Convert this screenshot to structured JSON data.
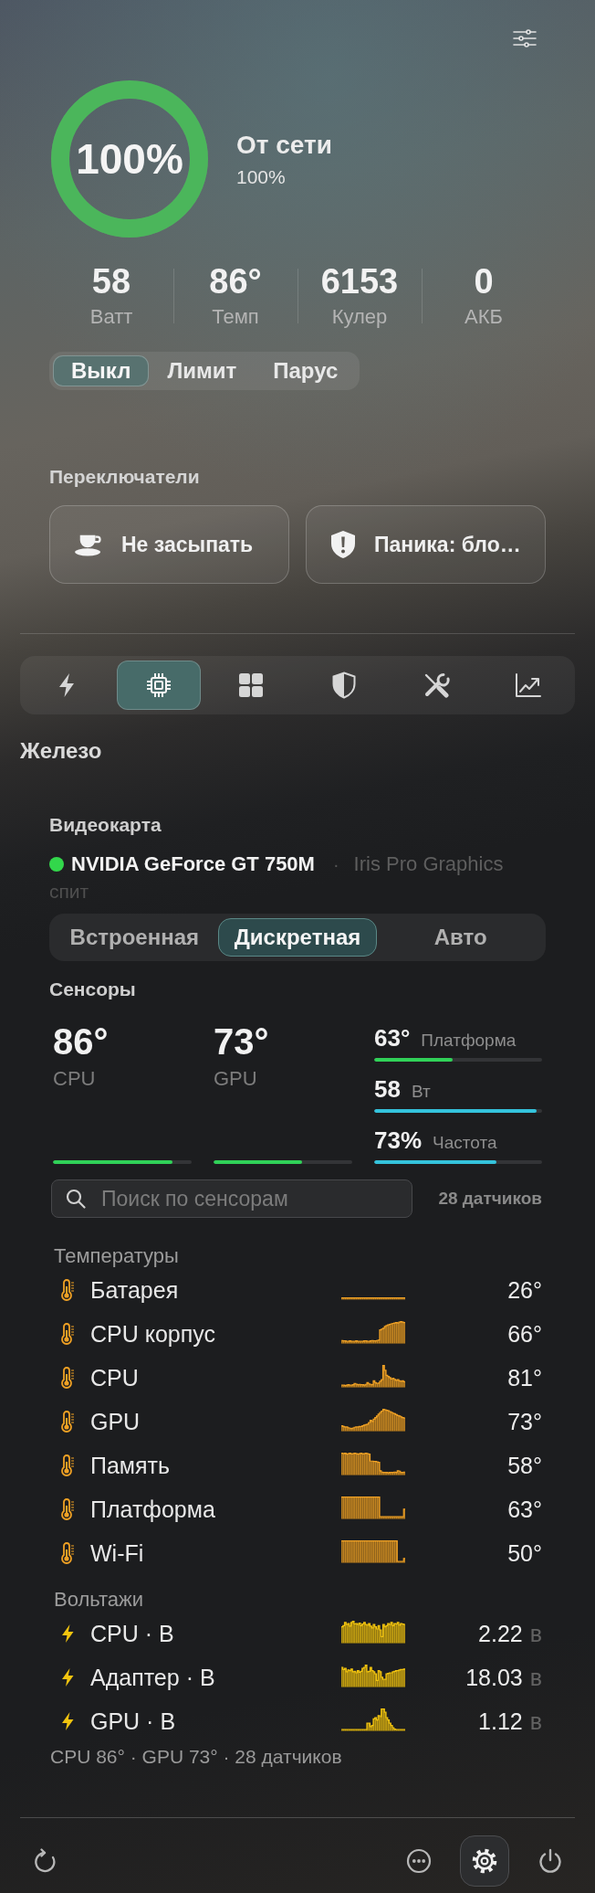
{
  "power": {
    "ring_label": "100%",
    "level": 1,
    "source": "От сети",
    "charge": "100%"
  },
  "stats": [
    {
      "value": "58",
      "label": "Ватт"
    },
    {
      "value": "86°",
      "label": "Темп"
    },
    {
      "value": "6153",
      "label": "Кулер"
    },
    {
      "value": "0",
      "label": "АКБ"
    }
  ],
  "charge_modes": [
    {
      "label": "Выкл",
      "selected": true
    },
    {
      "label": "Лимит",
      "selected": false
    },
    {
      "label": "Парус",
      "selected": false
    }
  ],
  "switches": {
    "heading": "Переключатели",
    "items": [
      {
        "label": "Не засыпать"
      },
      {
        "label": "Паника: бло…"
      }
    ]
  },
  "tabs": [
    {
      "selected": false
    },
    {
      "selected": true
    },
    {
      "selected": false
    },
    {
      "selected": false
    },
    {
      "selected": false
    },
    {
      "selected": false
    }
  ],
  "section_title": "Железо",
  "gpu": {
    "heading": "Видеокарта",
    "active": "NVIDIA GeForce GT 750M",
    "separator": "·",
    "inactive": "Iris Pro Graphics",
    "inactive_status": "спит",
    "modes": [
      {
        "label": "Встроенная",
        "selected": false
      },
      {
        "label": "Дискретная",
        "selected": true
      },
      {
        "label": "Авто",
        "selected": false
      }
    ]
  },
  "sensors": {
    "heading": "Сенсоры",
    "main": [
      {
        "value": "86°",
        "label": "CPU",
        "level": 0.86
      },
      {
        "value": "73°",
        "label": "GPU",
        "level": 0.64
      }
    ],
    "meters": [
      {
        "value": "63°",
        "label": "Платформа",
        "level": 0.47,
        "color": "#30d158"
      },
      {
        "value": "58",
        "label": "Вт",
        "level": 0.97,
        "color": "#34c3dc"
      },
      {
        "value": "73%",
        "label": "Частота",
        "level": 0.73,
        "color": "#34c3dc"
      }
    ],
    "search": {
      "placeholder": "Поиск по сенсорам"
    },
    "count": "28 датчиков",
    "groups": [
      {
        "kind": "temperature",
        "title": "Температуры",
        "rows": [
          {
            "name": "Батарея",
            "value": "26°"
          },
          {
            "name": "CPU корпус",
            "value": "66°"
          },
          {
            "name": "CPU",
            "value": "81°"
          },
          {
            "name": "GPU",
            "value": "73°"
          },
          {
            "name": "Память",
            "value": "58°"
          },
          {
            "name": "Платформа",
            "value": "63°"
          },
          {
            "name": "Wi-Fi",
            "value": "50°"
          }
        ]
      },
      {
        "kind": "voltage",
        "title": "Вольтажи",
        "rows": [
          {
            "name": "CPU · В",
            "value": "2.22",
            "unit": "в"
          },
          {
            "name": "Адаптер · В",
            "value": "18.03",
            "unit": "в"
          },
          {
            "name": "GPU · В",
            "value": "1.12",
            "unit": "в"
          }
        ]
      }
    ],
    "summary": "CPU 86° · GPU 73° · 28 датчиков"
  },
  "toolbar": [
    {
      "selected": false
    },
    {
      "selected": false
    },
    {
      "selected": true
    },
    {
      "selected": false
    }
  ]
}
